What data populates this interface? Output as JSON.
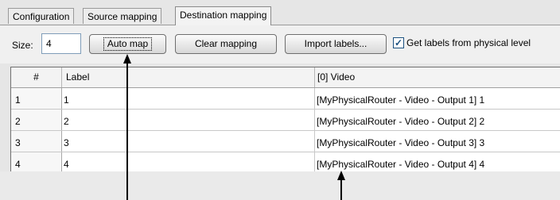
{
  "tabs": [
    {
      "label": "Configuration"
    },
    {
      "label": "Source mapping"
    },
    {
      "label": "Destination mapping"
    }
  ],
  "toolbar": {
    "size_label": "Size:",
    "size_value": "4",
    "auto_map_label": "Auto map",
    "clear_mapping_label": "Clear mapping",
    "import_labels_label": "Import labels...",
    "get_labels_checked": true,
    "get_labels_label": "Get labels from physical level"
  },
  "grid": {
    "headers": [
      "#",
      "Label",
      "[0] Video"
    ],
    "rows": [
      {
        "num": "1",
        "label": "1",
        "video": "[MyPhysicalRouter - Video - Output 1] 1"
      },
      {
        "num": "2",
        "label": "2",
        "video": "[MyPhysicalRouter - Video - Output 2] 2"
      },
      {
        "num": "3",
        "label": "3",
        "video": "[MyPhysicalRouter - Video - Output 3] 3"
      },
      {
        "num": "4",
        "label": "4",
        "video": "[MyPhysicalRouter - Video - Output 4] 4"
      }
    ]
  },
  "colors": {
    "checkbox": "#1c5180",
    "window_bg": "#e6e6e6"
  }
}
